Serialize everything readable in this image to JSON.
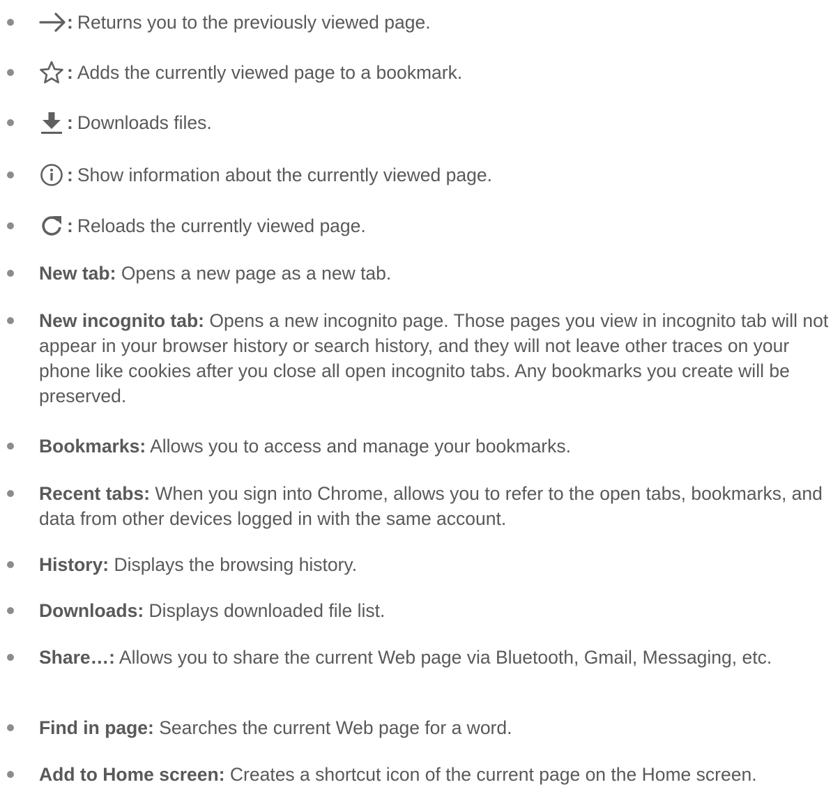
{
  "icon_items": [
    {
      "icon": "arrow-forward-icon",
      "colon": ":",
      "description": "Returns you to the previously viewed page."
    },
    {
      "icon": "star-outline-icon",
      "colon": ":",
      "description": "Adds the currently viewed page to a bookmark."
    },
    {
      "icon": "download-icon",
      "colon": ":",
      "description": "Downloads files."
    },
    {
      "icon": "info-icon",
      "colon": ":",
      "description": "Show information about the currently viewed page."
    },
    {
      "icon": "reload-icon",
      "colon": ":",
      "description": "Reloads the currently viewed page."
    }
  ],
  "menu_items": [
    {
      "term": "New tab:",
      "description": "Opens a new page as a new tab."
    },
    {
      "term": "New incognito tab:",
      "description": "Opens a new incognito page. Those pages you view in incognito tab will not appear in your browser history or search history, and they will not leave other traces on your phone like cookies after you close all open incognito tabs. Any bookmarks you create will be preserved."
    },
    {
      "term": "Bookmarks:",
      "description": "Allows you to access and manage your bookmarks."
    },
    {
      "term": "Recent tabs:",
      "description": "When you sign into Chrome, allows you to refer to the open tabs, bookmarks, and data from other devices logged in with the same account."
    },
    {
      "term": "History:",
      "description": "Displays the browsing history."
    },
    {
      "term": "Downloads:",
      "description": "Displays downloaded file list."
    },
    {
      "term": "Share…:",
      "description": "Allows you to share the current Web page via Bluetooth, Gmail, Messaging, etc."
    },
    {
      "term": "Find in page:",
      "description": "Searches the current Web page for a word."
    },
    {
      "term": "Add to Home screen:",
      "description": "Creates a shortcut icon of the current page on the Home screen."
    }
  ],
  "colors": {
    "text": "#595959",
    "bullet": "#8c8c8c",
    "icon": "#5f5f5f"
  }
}
